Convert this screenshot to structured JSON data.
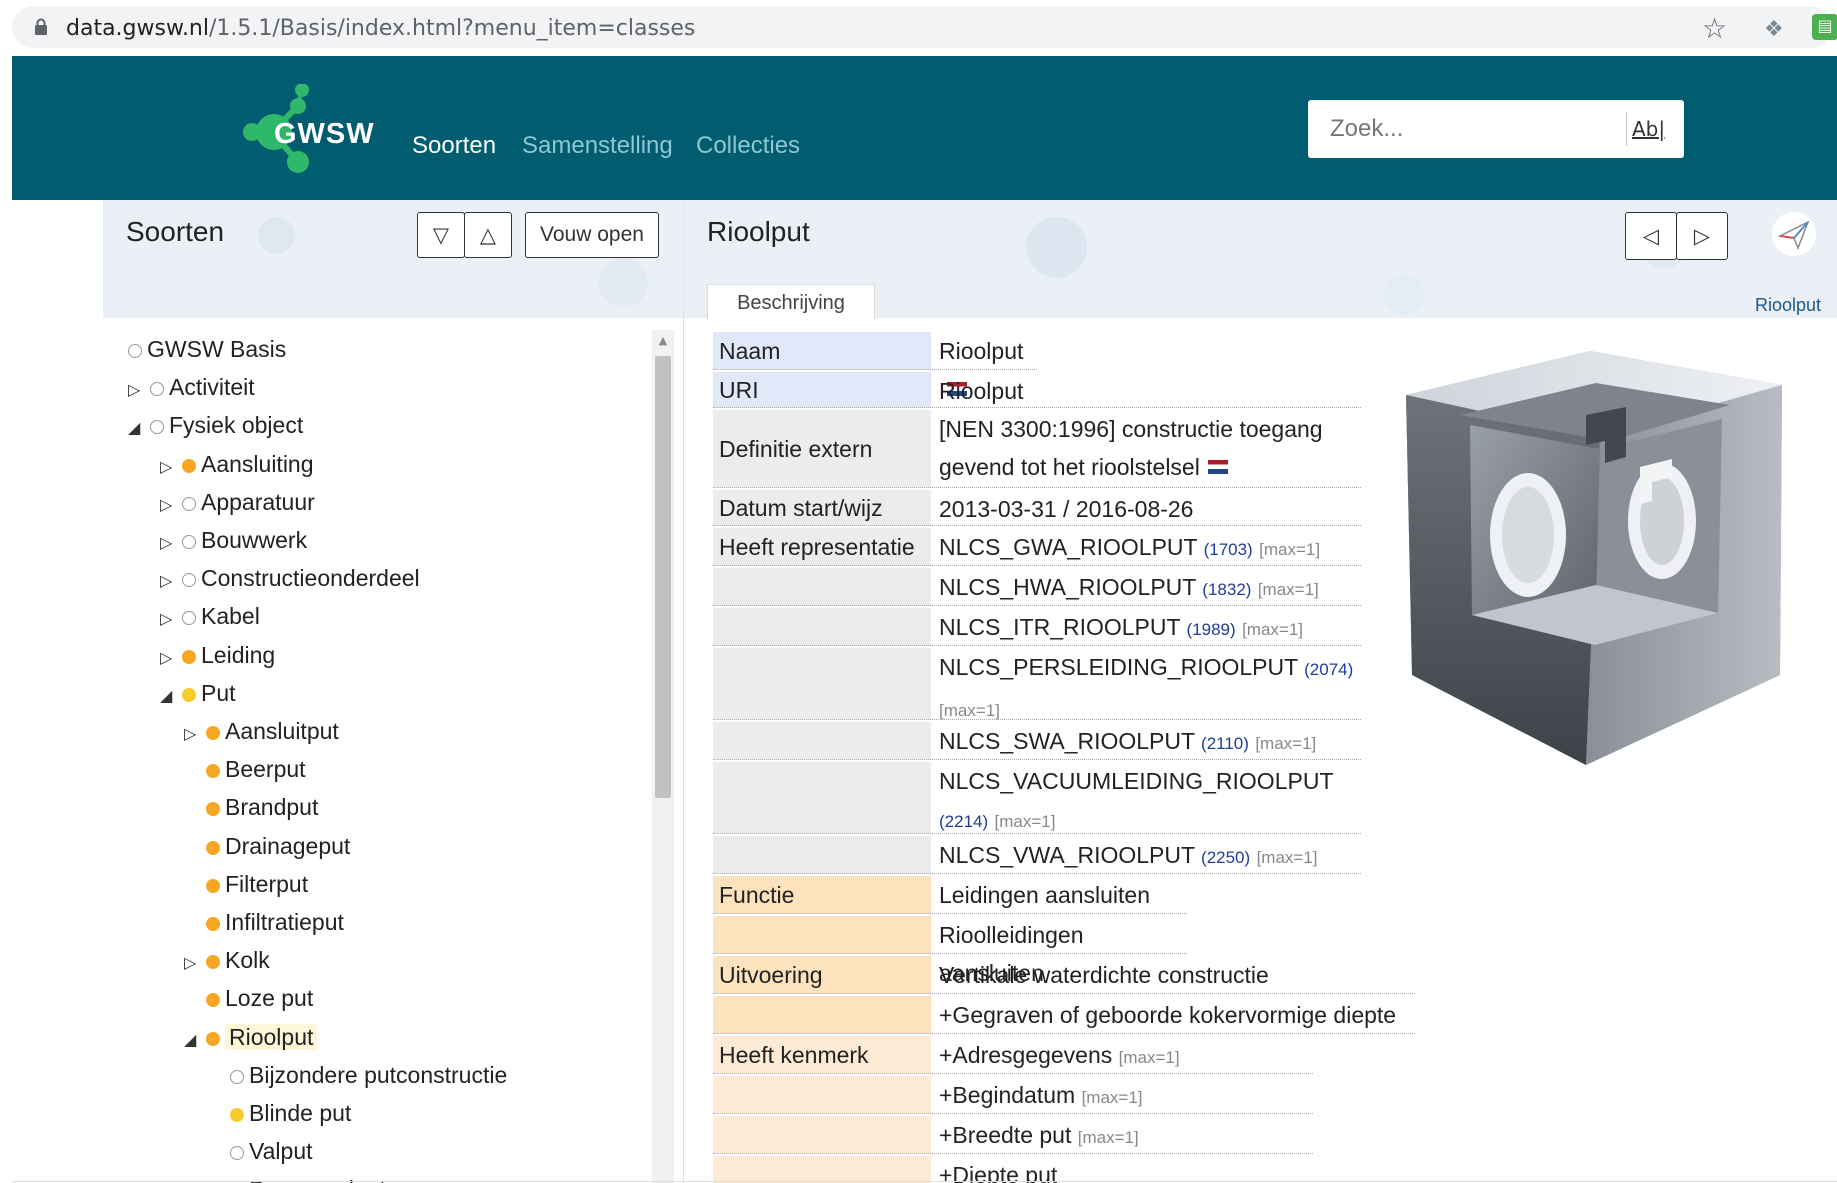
{
  "browser": {
    "url_host": "data.gwsw.nl",
    "url_path": "/1.5.1/Basis/index.html?menu_item=classes"
  },
  "navbar": {
    "logo": "GWSW",
    "items": [
      "Soorten",
      "Samenstelling",
      "Collecties"
    ],
    "active": "Soorten",
    "search_placeholder": "Zoek...",
    "search_button": "Ab|"
  },
  "left_panel": {
    "title": "Soorten",
    "expand_label": "Vouw open"
  },
  "tree": [
    {
      "label": "GWSW Basis",
      "level": 0,
      "toggle": "none",
      "bullet": "empty"
    },
    {
      "label": "Activiteit",
      "level": 0,
      "toggle": "collapsed",
      "bullet": "empty"
    },
    {
      "label": "Fysiek object",
      "level": 0,
      "toggle": "expanded",
      "bullet": "empty"
    },
    {
      "label": "Aansluiting",
      "level": 1,
      "toggle": "collapsed",
      "bullet": "orange"
    },
    {
      "label": "Apparatuur",
      "level": 1,
      "toggle": "collapsed",
      "bullet": "empty"
    },
    {
      "label": "Bouwwerk",
      "level": 1,
      "toggle": "collapsed",
      "bullet": "empty"
    },
    {
      "label": "Constructieonderdeel",
      "level": 1,
      "toggle": "collapsed",
      "bullet": "empty"
    },
    {
      "label": "Kabel",
      "level": 1,
      "toggle": "collapsed",
      "bullet": "empty"
    },
    {
      "label": "Leiding",
      "level": 1,
      "toggle": "collapsed",
      "bullet": "orange"
    },
    {
      "label": "Put",
      "level": 1,
      "toggle": "expanded",
      "bullet": "yellow"
    },
    {
      "label": "Aansluitput",
      "level": 2,
      "toggle": "collapsed",
      "bullet": "orange"
    },
    {
      "label": "Beerput",
      "level": 2,
      "toggle": "none",
      "bullet": "orange"
    },
    {
      "label": "Brandput",
      "level": 2,
      "toggle": "none",
      "bullet": "orange"
    },
    {
      "label": "Drainageput",
      "level": 2,
      "toggle": "none",
      "bullet": "orange"
    },
    {
      "label": "Filterput",
      "level": 2,
      "toggle": "none",
      "bullet": "orange"
    },
    {
      "label": "Infiltratieput",
      "level": 2,
      "toggle": "none",
      "bullet": "orange"
    },
    {
      "label": "Kolk",
      "level": 2,
      "toggle": "collapsed",
      "bullet": "orange"
    },
    {
      "label": "Loze put",
      "level": 2,
      "toggle": "none",
      "bullet": "orange"
    },
    {
      "label": "Rioolput",
      "level": 2,
      "toggle": "expanded",
      "bullet": "orange",
      "selected": true
    },
    {
      "label": "Bijzondere putconstructie",
      "level": 3,
      "toggle": "none",
      "bullet": "empty"
    },
    {
      "label": "Blinde put",
      "level": 3,
      "toggle": "none",
      "bullet": "yellow"
    },
    {
      "label": "Valput",
      "level": 3,
      "toggle": "none",
      "bullet": "empty"
    },
    {
      "label": "Doorspoelput",
      "level": 3,
      "toggle": "none",
      "bullet": "orange"
    }
  ],
  "right_panel": {
    "title": "Rioolput",
    "tab": "Beschrijving",
    "breadcrumb": "Rioolput"
  },
  "properties": [
    {
      "label": "Naam",
      "value": "Rioolput",
      "flag": true,
      "tone": "blue"
    },
    {
      "label": "URI",
      "value": "Rioolput",
      "tone": "blue"
    },
    {
      "label": "Definitie extern",
      "value": "[NEN 3300:1996] constructie toegang gevend tot het rioolstelsel",
      "flag": true,
      "tone": "gray"
    },
    {
      "label": "Datum start/wijz",
      "value": "2013-03-31 / 2016-08-26",
      "tone": "gray"
    },
    {
      "label": "Heeft representatie",
      "value": "NLCS_GWA_RIOOLPUT",
      "code": "(1703)",
      "max": "[max=1]",
      "tone": "gray"
    },
    {
      "label": "",
      "value": "NLCS_HWA_RIOOLPUT",
      "code": "(1832)",
      "max": "[max=1]",
      "tone": "gray"
    },
    {
      "label": "",
      "value": "NLCS_ITR_RIOOLPUT",
      "code": "(1989)",
      "max": "[max=1]",
      "tone": "gray"
    },
    {
      "label": "",
      "value": "NLCS_PERSLEIDING_RIOOLPUT",
      "code": "(2074)",
      "max": "[max=1]",
      "tone": "gray"
    },
    {
      "label": "",
      "value": "NLCS_SWA_RIOOLPUT",
      "code": "(2110)",
      "max": "[max=1]",
      "tone": "gray"
    },
    {
      "label": "",
      "value": "NLCS_VACUUMLEIDING_RIOOLPUT",
      "code": "(2214)",
      "max": "[max=1]",
      "tone": "gray"
    },
    {
      "label": "",
      "value": "NLCS_VWA_RIOOLPUT",
      "code": "(2250)",
      "max": "[max=1]",
      "tone": "gray"
    },
    {
      "label": "Functie",
      "value": "Leidingen aansluiten",
      "tone": "orange"
    },
    {
      "label": "",
      "value": "Rioolleidingen aansluiten",
      "tone": "orange"
    },
    {
      "label": "Uitvoering",
      "value": "Vertikale waterdichte constructie",
      "tone": "orange"
    },
    {
      "label": "",
      "value": "+Gegraven of geboorde kokervormige diepte",
      "tone": "orange"
    },
    {
      "label": "Heeft kenmerk",
      "value": "+Adresgegevens",
      "max": "[max=1]",
      "tone": "peach"
    },
    {
      "label": "",
      "value": "+Begindatum",
      "max": "[max=1]",
      "tone": "peach"
    },
    {
      "label": "",
      "value": "+Breedte put",
      "max": "[max=1]",
      "tone": "peach"
    },
    {
      "label": "",
      "value": "+Diepte put",
      "max": "",
      "tone": "peach"
    }
  ],
  "colors": {
    "navbar": "#005c6f",
    "nav_active": "#ffffff",
    "nav_inactive": "#8ec6d1",
    "bullet_orange": "#f5a623",
    "bullet_yellow": "#f8cc2a",
    "label_blue": "#e1e8fa",
    "label_orange": "#fde3bd",
    "code_blue": "#1f3d9a"
  }
}
